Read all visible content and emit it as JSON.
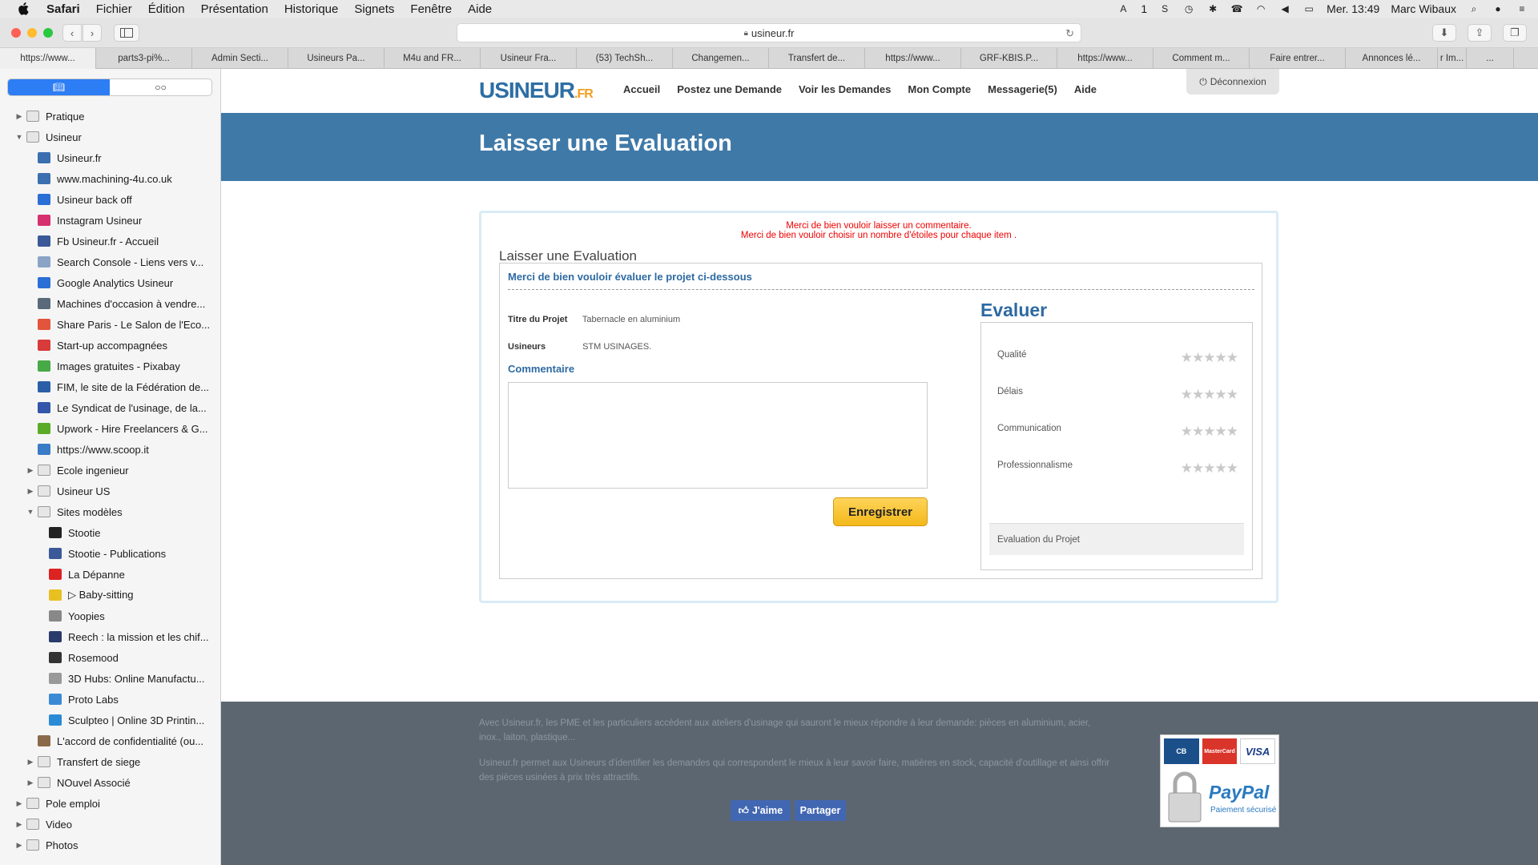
{
  "menubar": {
    "app": "Safari",
    "items": [
      "Fichier",
      "Édition",
      "Présentation",
      "Historique",
      "Signets",
      "Fenêtre",
      "Aide"
    ],
    "badge_count": "1",
    "datetime": "Mer. 13:49",
    "user": "Marc Wibaux"
  },
  "toolbar": {
    "url": "usineur.fr"
  },
  "tabs": [
    "https://www...",
    "parts3-pi%...",
    "Admin Secti...",
    "Usineurs Pa...",
    "M4u and FR...",
    "Usineur Fra...",
    "(53) TechSh...",
    "Changemen...",
    "Transfert de...",
    "https://www...",
    "GRF-KBIS.P...",
    "https://www...",
    "Comment m...",
    "Faire entrer...",
    "Annonces lé...",
    "r Im...",
    "..."
  ],
  "sidebar": {
    "items": [
      {
        "label": "Pratique",
        "level": 0,
        "type": "folder",
        "expanded": false
      },
      {
        "label": "Usineur",
        "level": 0,
        "type": "folder",
        "expanded": true
      },
      {
        "label": "Usineur.fr",
        "level": 1,
        "type": "link",
        "icon": "usineur-icon",
        "color": "#3b6fb0"
      },
      {
        "label": "www.machining-4u.co.uk",
        "level": 1,
        "type": "link",
        "icon": "machining-icon",
        "color": "#3b6fb0"
      },
      {
        "label": "Usineur back off",
        "level": 1,
        "type": "link",
        "icon": "globe-icon",
        "color": "#2a6fd6"
      },
      {
        "label": "Instagram Usineur",
        "level": 1,
        "type": "link",
        "icon": "instagram-icon",
        "color": "#d6306e"
      },
      {
        "label": "Fb Usineur.fr - Accueil",
        "level": 1,
        "type": "link",
        "icon": "facebook-icon",
        "color": "#3b5998"
      },
      {
        "label": "Search Console - Liens vers v...",
        "level": 1,
        "type": "link",
        "icon": "search-console-icon",
        "color": "#8aa4c8"
      },
      {
        "label": "Google Analytics Usineur",
        "level": 1,
        "type": "link",
        "icon": "globe-icon",
        "color": "#2a6fd6"
      },
      {
        "label": "Machines d'occasion à vendre...",
        "level": 1,
        "type": "link",
        "icon": "tools-icon",
        "color": "#5a6a7a"
      },
      {
        "label": "Share Paris - Le Salon de l'Eco...",
        "level": 1,
        "type": "link",
        "icon": "share-paris-icon",
        "color": "#e2543c"
      },
      {
        "label": "Start-up accompagnées",
        "level": 1,
        "type": "link",
        "icon": "startup-icon",
        "color": "#d93a3a"
      },
      {
        "label": "Images gratuites - Pixabay",
        "level": 1,
        "type": "link",
        "icon": "pixabay-icon",
        "color": "#48a947"
      },
      {
        "label": "FIM, le site de la Fédération de...",
        "level": 1,
        "type": "link",
        "icon": "fim-icon",
        "color": "#2a5fa8"
      },
      {
        "label": "Le Syndicat de l'usinage, de la...",
        "level": 1,
        "type": "link",
        "icon": "pen-icon",
        "color": "#3355aa"
      },
      {
        "label": "Upwork - Hire Freelancers & G...",
        "level": 1,
        "type": "link",
        "icon": "upwork-icon",
        "color": "#5bab28"
      },
      {
        "label": "https://www.scoop.it",
        "level": 1,
        "type": "link",
        "icon": "scoop-icon",
        "color": "#3a7bc8"
      },
      {
        "label": "Ecole ingenieur",
        "level": 1,
        "type": "folder",
        "expanded": false
      },
      {
        "label": "Usineur US",
        "level": 1,
        "type": "folder",
        "expanded": false
      },
      {
        "label": "Sites modèles",
        "level": 1,
        "type": "folder",
        "expanded": true
      },
      {
        "label": "Stootie",
        "level": 2,
        "type": "link",
        "icon": "stootie-icon",
        "color": "#222"
      },
      {
        "label": "Stootie - Publications",
        "level": 2,
        "type": "link",
        "icon": "facebook-icon",
        "color": "#3b5998"
      },
      {
        "label": "La Dépanne",
        "level": 2,
        "type": "link",
        "icon": "depanne-icon",
        "color": "#d22"
      },
      {
        "label": "▷ Baby-sitting",
        "level": 2,
        "type": "link",
        "icon": "babysitting-icon",
        "color": "#e8c020"
      },
      {
        "label": "Yoopies",
        "level": 2,
        "type": "link",
        "icon": "yoopies-icon",
        "color": "#888"
      },
      {
        "label": "Reech : la mission et les chif...",
        "level": 2,
        "type": "link",
        "icon": "reech-icon",
        "color": "#2a3a6a"
      },
      {
        "label": "Rosemood",
        "level": 2,
        "type": "link",
        "icon": "rosemood-icon",
        "color": "#333"
      },
      {
        "label": "3D Hubs: Online Manufactu...",
        "level": 2,
        "type": "link",
        "icon": "hubs-icon",
        "color": "#999"
      },
      {
        "label": "Proto Labs",
        "level": 2,
        "type": "link",
        "icon": "protolabs-icon",
        "color": "#3a8ad6"
      },
      {
        "label": "Sculpteo | Online 3D Printin...",
        "level": 2,
        "type": "link",
        "icon": "sculpteo-icon",
        "color": "#2a8ad6"
      },
      {
        "label": "L'accord de confidentialité (ou...",
        "level": 1,
        "type": "link",
        "icon": "avatar-icon",
        "color": "#8a6a4a"
      },
      {
        "label": "Transfert de siege",
        "level": 1,
        "type": "folder",
        "expanded": false
      },
      {
        "label": "NOuvel Associé",
        "level": 1,
        "type": "folder",
        "expanded": false
      },
      {
        "label": "Pole emploi",
        "level": 0,
        "type": "folder",
        "expanded": false
      },
      {
        "label": "Video",
        "level": 0,
        "type": "folder",
        "expanded": false
      },
      {
        "label": "Photos",
        "level": 0,
        "type": "folder",
        "expanded": false
      }
    ]
  },
  "site": {
    "logo_main": "USINEUR",
    "logo_suffix": ".FR",
    "nav": [
      "Accueil",
      "Postez une Demande",
      "Voir les Demandes",
      "Mon Compte",
      "Messagerie(5)",
      "Aide"
    ],
    "logout": "Déconnexion",
    "banner_title": "Laisser une Evaluation"
  },
  "form": {
    "error1": "Merci de bien vouloir laisser un commentaire.",
    "error2": "Merci de bien vouloir choisir un nombre d'étoiles pour chaque item .",
    "title": "Laisser une Evaluation",
    "subtitle": "Merci de bien vouloir évaluer le projet ci-dessous",
    "project_label": "Titre du Projet",
    "project_value": "Tabernacle en aluminium",
    "usineurs_label": "Usineurs",
    "usineurs_value": "STM USINAGES.",
    "comment_label": "Commentaire",
    "comment_value": "",
    "save_label": "Enregistrer",
    "evaluate_title": "Evaluer",
    "criteria": [
      {
        "label": "Qualité",
        "rating": 0,
        "max": 5
      },
      {
        "label": "Délais",
        "rating": 0,
        "max": 5
      },
      {
        "label": "Communication",
        "rating": 0,
        "max": 5
      },
      {
        "label": "Professionnalisme",
        "rating": 0,
        "max": 5
      }
    ],
    "evaluation_footer": "Evaluation du Projet"
  },
  "footer": {
    "text1": "Avec Usineur.fr, les PME et les particuliers accèdent aux ateliers d'usinage qui sauront le mieux répondre à leur demande: pièces en aluminium, acier, inox., laiton, plastique...",
    "text2": "Usineur.fr permet aux Usineurs d'identifier les demandes qui correspondent le mieux à leur savoir faire, matières en stock, capacité d'outillage et ainsi offrir des pièces usinées à prix très attractifs.",
    "like_label": "J'aime",
    "share_label": "Partager",
    "card_cb": "CB",
    "card_mastercard": "MasterCard",
    "card_visa": "VISA",
    "paypal": "PayPal",
    "paypal_sub": "Paiement sécurisé"
  }
}
